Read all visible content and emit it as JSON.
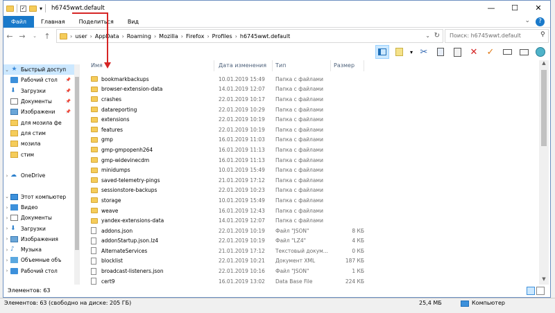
{
  "window": {
    "title": "h6745wwt.default"
  },
  "ribbon": {
    "tabs": [
      "Файл",
      "Главная",
      "Поделиться",
      "Вид"
    ]
  },
  "address": {
    "crumbs": [
      "user",
      "AppData",
      "Roaming",
      "Mozilla",
      "Firefox",
      "Profiles",
      "h6745wwt.default"
    ]
  },
  "search": {
    "placeholder": "Поиск: h6745wwt.default"
  },
  "nav": {
    "items": [
      {
        "label": "Быстрый доступ",
        "icon": "star-icon",
        "kind": "star",
        "expand": "v",
        "selected": true,
        "pin": false
      },
      {
        "label": "Рабочий стол",
        "icon": "desktop-icon",
        "kind": "blue",
        "expand": "",
        "selected": false,
        "pin": true
      },
      {
        "label": "Загрузки",
        "icon": "download-icon",
        "kind": "down",
        "expand": "",
        "selected": false,
        "pin": true
      },
      {
        "label": "Документы",
        "icon": "document-icon",
        "kind": "doc",
        "expand": "",
        "selected": false,
        "pin": true
      },
      {
        "label": "Изображени",
        "icon": "pictures-icon",
        "kind": "img",
        "expand": "",
        "selected": false,
        "pin": true
      },
      {
        "label": "для мозила фе",
        "icon": "folder-icon",
        "kind": "yel",
        "expand": "",
        "selected": false,
        "pin": false
      },
      {
        "label": "для стим",
        "icon": "folder-icon",
        "kind": "yel",
        "expand": "",
        "selected": false,
        "pin": false
      },
      {
        "label": "мозила",
        "icon": "folder-icon",
        "kind": "yel",
        "expand": "",
        "selected": false,
        "pin": false
      },
      {
        "label": "стим",
        "icon": "folder-icon",
        "kind": "yel",
        "expand": "",
        "selected": false,
        "pin": false
      },
      {
        "label": "",
        "icon": "",
        "kind": "",
        "expand": "",
        "selected": false,
        "pin": false
      },
      {
        "label": "OneDrive",
        "icon": "onedrive-icon",
        "kind": "cloud",
        "expand": ">",
        "selected": false,
        "pin": false
      },
      {
        "label": "",
        "icon": "",
        "kind": "",
        "expand": "",
        "selected": false,
        "pin": false
      },
      {
        "label": "Этот компьютер",
        "icon": "computer-icon",
        "kind": "pc",
        "expand": "v",
        "selected": false,
        "pin": false
      },
      {
        "label": "Видео",
        "icon": "video-icon",
        "kind": "vid",
        "expand": ">",
        "selected": false,
        "pin": false
      },
      {
        "label": "Документы",
        "icon": "document-icon",
        "kind": "doc",
        "expand": ">",
        "selected": false,
        "pin": false
      },
      {
        "label": "Загрузки",
        "icon": "download-icon",
        "kind": "down",
        "expand": ">",
        "selected": false,
        "pin": false
      },
      {
        "label": "Изображения",
        "icon": "pictures-icon",
        "kind": "img",
        "expand": ">",
        "selected": false,
        "pin": false
      },
      {
        "label": "Музыка",
        "icon": "music-icon",
        "kind": "mus",
        "expand": ">",
        "selected": false,
        "pin": false
      },
      {
        "label": "Объемные объ",
        "icon": "3d-objects-icon",
        "kind": "cube",
        "expand": ">",
        "selected": false,
        "pin": false
      },
      {
        "label": "Рабочий стол",
        "icon": "desktop-icon",
        "kind": "blue",
        "expand": ">",
        "selected": false,
        "pin": false
      }
    ]
  },
  "columns": {
    "name": "Имя",
    "date": "Дата изменения",
    "type": "Тип",
    "size": "Размер"
  },
  "files": [
    {
      "name": "bookmarkbackups",
      "date": "10.01.2019 15:49",
      "type": "Папка с файлами",
      "size": "",
      "folder": true
    },
    {
      "name": "browser-extension-data",
      "date": "14.01.2019 12:07",
      "type": "Папка с файлами",
      "size": "",
      "folder": true
    },
    {
      "name": "crashes",
      "date": "22.01.2019 10:17",
      "type": "Папка с файлами",
      "size": "",
      "folder": true
    },
    {
      "name": "datareporting",
      "date": "22.01.2019 10:29",
      "type": "Папка с файлами",
      "size": "",
      "folder": true
    },
    {
      "name": "extensions",
      "date": "22.01.2019 10:19",
      "type": "Папка с файлами",
      "size": "",
      "folder": true
    },
    {
      "name": "features",
      "date": "22.01.2019 10:19",
      "type": "Папка с файлами",
      "size": "",
      "folder": true
    },
    {
      "name": "gmp",
      "date": "16.01.2019 11:03",
      "type": "Папка с файлами",
      "size": "",
      "folder": true
    },
    {
      "name": "gmp-gmpopenh264",
      "date": "16.01.2019 11:13",
      "type": "Папка с файлами",
      "size": "",
      "folder": true
    },
    {
      "name": "gmp-widevinecdm",
      "date": "16.01.2019 11:13",
      "type": "Папка с файлами",
      "size": "",
      "folder": true
    },
    {
      "name": "minidumps",
      "date": "10.01.2019 15:49",
      "type": "Папка с файлами",
      "size": "",
      "folder": true
    },
    {
      "name": "saved-telemetry-pings",
      "date": "21.01.2019 17:12",
      "type": "Папка с файлами",
      "size": "",
      "folder": true
    },
    {
      "name": "sessionstore-backups",
      "date": "22.01.2019 10:23",
      "type": "Папка с файлами",
      "size": "",
      "folder": true
    },
    {
      "name": "storage",
      "date": "10.01.2019 15:49",
      "type": "Папка с файлами",
      "size": "",
      "folder": true
    },
    {
      "name": "weave",
      "date": "16.01.2019 12:43",
      "type": "Папка с файлами",
      "size": "",
      "folder": true
    },
    {
      "name": "yandex-extensions-data",
      "date": "14.01.2019 12:07",
      "type": "Папка с файлами",
      "size": "",
      "folder": true
    },
    {
      "name": "addons.json",
      "date": "22.01.2019 10:19",
      "type": "Файл \"JSON\"",
      "size": "8 КБ",
      "folder": false
    },
    {
      "name": "addonStartup.json.lz4",
      "date": "22.01.2019 10:19",
      "type": "Файл \"LZ4\"",
      "size": "4 КБ",
      "folder": false
    },
    {
      "name": "AlternateServices",
      "date": "21.01.2019 17:12",
      "type": "Текстовый докум...",
      "size": "0 КБ",
      "folder": false
    },
    {
      "name": "blocklist",
      "date": "22.01.2019 10:21",
      "type": "Документ XML",
      "size": "187 КБ",
      "folder": false
    },
    {
      "name": "broadcast-listeners.json",
      "date": "22.01.2019 10:16",
      "type": "Файл \"JSON\"",
      "size": "1 КБ",
      "folder": false
    },
    {
      "name": "cert9",
      "date": "16.01.2019 13:02",
      "type": "Data Base File",
      "size": "224 КБ",
      "folder": false
    }
  ],
  "statusbar": {
    "count": "Элементов: 63"
  },
  "bottom": {
    "left": "Элементов: 63 (свободно на диске: 205 ГБ)",
    "size": "25,4 МБ",
    "location": "Компьютер"
  },
  "colors": {
    "accent": "#1979ca",
    "annotation_arrow": "#d62424"
  }
}
